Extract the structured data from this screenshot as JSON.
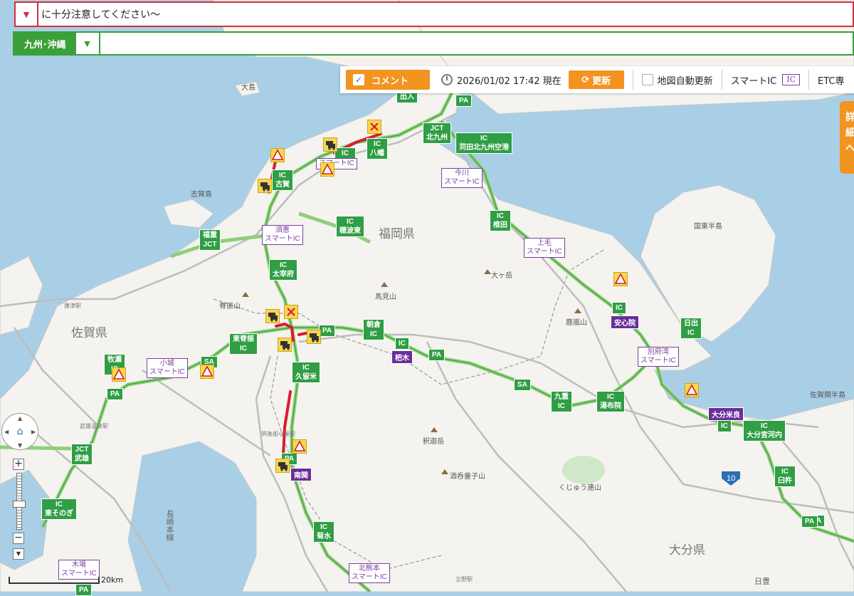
{
  "alert": {
    "text": "に十分注意してください〜",
    "toggle_icon": "triangle-down-icon"
  },
  "region": {
    "label": "九州･沖縄",
    "toggle_icon": "triangle-down-icon"
  },
  "toolbar": {
    "comment_label": "コメント",
    "datetime": "2026/01/02 17:42 現在",
    "update_label": "更新",
    "auto_update_label": "地図自動更新",
    "smart_ic_label": "スマートIC",
    "ic_badge": "IC",
    "etc_label": "ETC専"
  },
  "side_tab": {
    "chars": [
      "詳",
      "細",
      "へ"
    ]
  },
  "scale": {
    "label": "20km"
  },
  "colors": {
    "green": "#3aa03a",
    "road_green": "#8fce7a",
    "congestion_red": "#d81e2c",
    "purple": "#7b3fa0",
    "orange": "#f39320",
    "sea": "#a9cfe6",
    "land": "#f4f3ef"
  },
  "map": {
    "prefecture_labels": [
      "福岡県",
      "佐賀県",
      "大分県"
    ],
    "place_labels": [
      "大島",
      "志賀島",
      "国東半島",
      "佐賀関半島",
      "脊振山",
      "馬見山",
      "大ヶ岳",
      "鹿嵐山",
      "釈迦岳",
      "酒呑童子山",
      "くじゅう連山",
      "長崎本線",
      "唐津駅",
      "武雄温泉駅",
      "筑後船小屋駅",
      "立野駅",
      "日豊"
    ],
    "green_signs": [
      {
        "lines": [
          "出入"
        ]
      },
      {
        "lines": [
          "PA"
        ]
      },
      {
        "lines": [
          "JCT",
          "北九州"
        ]
      },
      {
        "lines": [
          "IC",
          "苅田北九州空港"
        ]
      },
      {
        "lines": [
          "IC",
          "八幡"
        ]
      },
      {
        "lines": [
          "IC",
          "古賀"
        ]
      },
      {
        "lines": [
          "IC",
          "椎田"
        ]
      },
      {
        "lines": [
          "IC",
          "篠栗"
        ]
      },
      {
        "lines": [
          "IC",
          "穂波東"
        ]
      },
      {
        "lines": [
          "福重",
          "JCT"
        ]
      },
      {
        "lines": [
          "IC",
          "太宰府"
        ]
      },
      {
        "lines": [
          "PA"
        ]
      },
      {
        "lines": [
          "朝倉",
          "IC"
        ]
      },
      {
        "lines": [
          "IC"
        ]
      },
      {
        "lines": [
          "PA"
        ]
      },
      {
        "lines": [
          "東脊振",
          "IC"
        ]
      },
      {
        "lines": [
          "IC",
          "久留米"
        ]
      },
      {
        "lines": [
          "牧瀬",
          "IC"
        ]
      },
      {
        "lines": [
          "PA"
        ]
      },
      {
        "lines": [
          "SA"
        ]
      },
      {
        "lines": [
          "SA"
        ]
      },
      {
        "lines": [
          "PA"
        ]
      },
      {
        "lines": [
          "九重",
          "IC"
        ]
      },
      {
        "lines": [
          "IC",
          "湯布院"
        ]
      },
      {
        "lines": [
          "IC"
        ]
      },
      {
        "lines": [
          "日出",
          "IC"
        ]
      },
      {
        "lines": [
          "IC"
        ]
      },
      {
        "lines": [
          "IC",
          "大分宮河内"
        ]
      },
      {
        "lines": [
          "IC",
          "臼杵"
        ]
      },
      {
        "lines": [
          "PA"
        ]
      },
      {
        "lines": [
          "JCT",
          "武雄"
        ]
      },
      {
        "lines": [
          "IC",
          "東そのぎ"
        ]
      },
      {
        "lines": [
          "IC"
        ]
      },
      {
        "lines": [
          "IC",
          "菊水"
        ]
      },
      {
        "lines": [
          "PA"
        ]
      },
      {
        "lines": [
          "PA"
        ]
      }
    ],
    "smart_ic_signs": [
      {
        "lines": [
          "今川",
          "スマートIC"
        ]
      },
      {
        "lines": [
          "須恵",
          "スマートIC"
        ]
      },
      {
        "lines": [
          "上毛",
          "スマートIC"
        ]
      },
      {
        "lines": [
          "小城",
          "スマートIC"
        ]
      },
      {
        "lines": [
          "別府湾",
          "スマートIC"
        ]
      },
      {
        "lines": [
          "北熊本",
          "スマートIC"
        ]
      },
      {
        "lines": [
          "木場",
          "スマートIC"
        ]
      },
      {
        "lines": [
          "スマートIC"
        ]
      }
    ],
    "purple_signs": [
      "安心院",
      "杷木",
      "南関",
      "大分米良"
    ],
    "route_number": "10",
    "incident_icons": [
      "caution-icon",
      "closure-icon",
      "congestion-car-icon"
    ]
  }
}
